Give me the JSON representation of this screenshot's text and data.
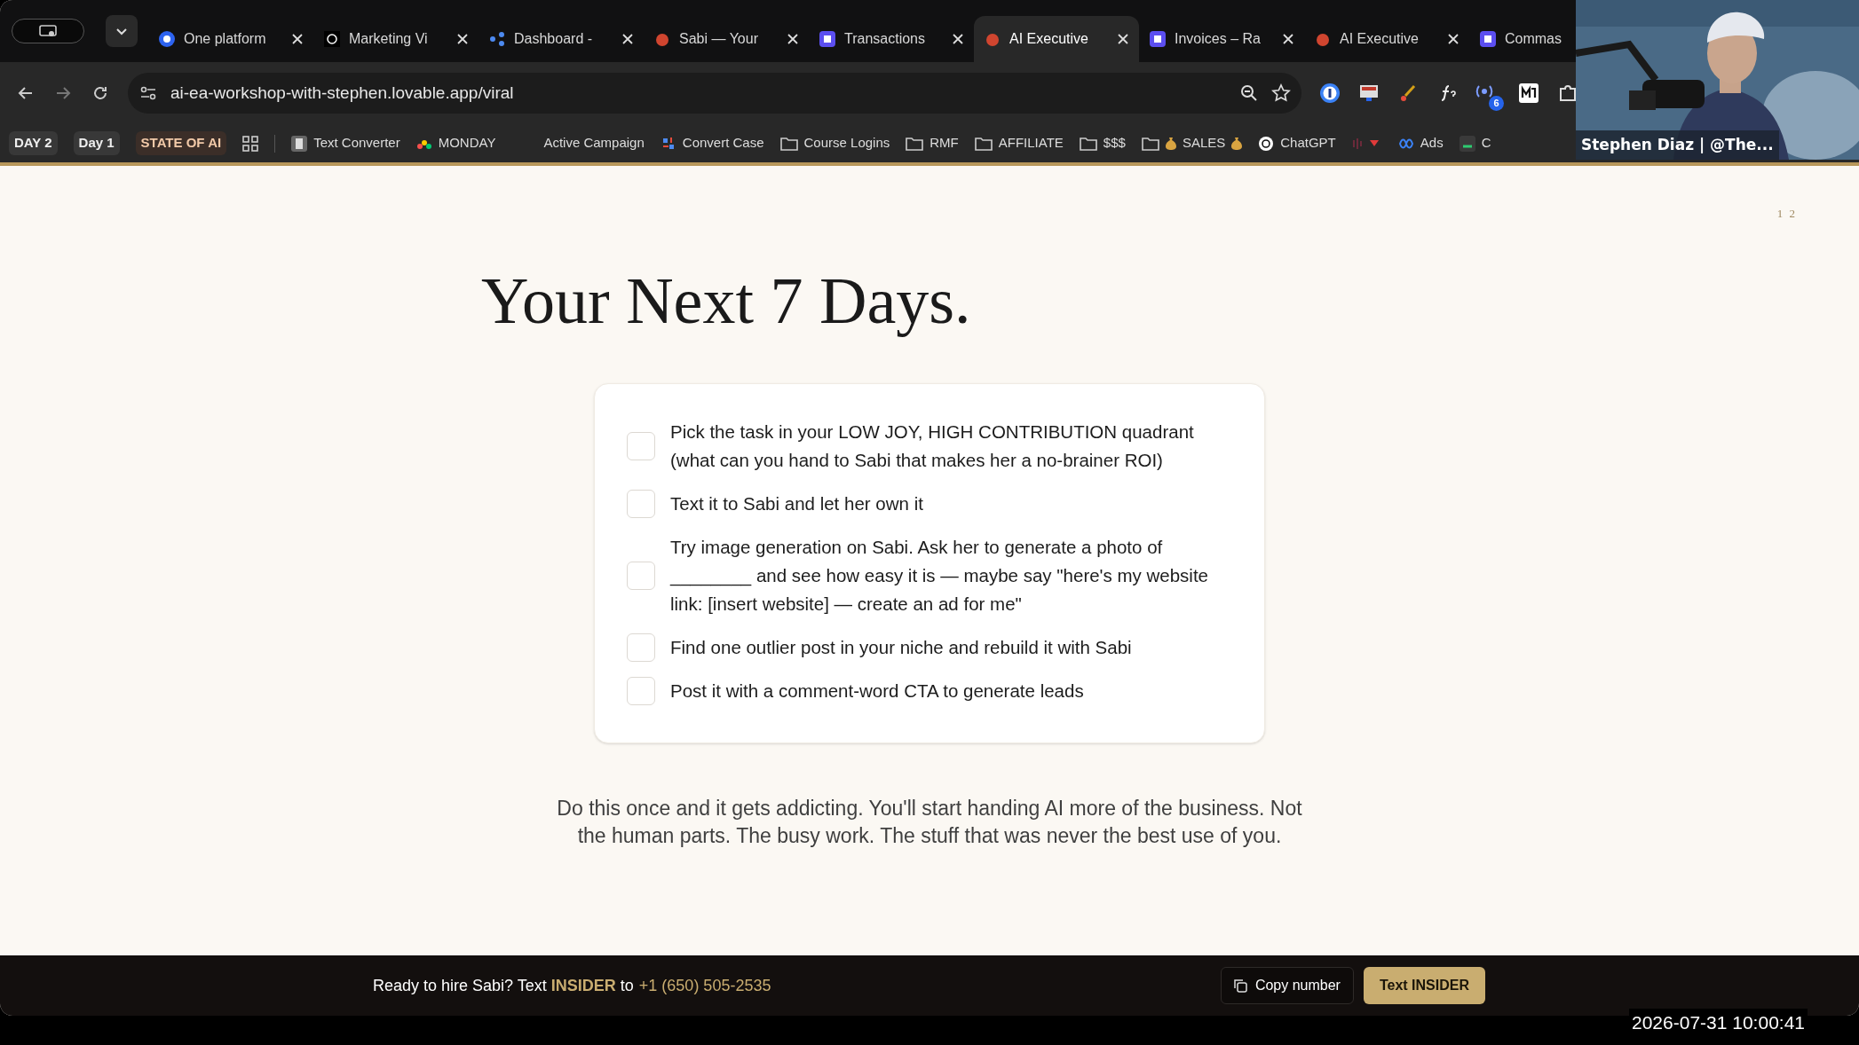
{
  "browser": {
    "tabs": [
      {
        "title": "One platform",
        "selected": false
      },
      {
        "title": "Marketing Vi",
        "selected": false
      },
      {
        "title": "Dashboard -",
        "selected": false
      },
      {
        "title": "Sabi — Your",
        "selected": false
      },
      {
        "title": "Transactions",
        "selected": false
      },
      {
        "title": "AI Executive",
        "selected": true
      },
      {
        "title": "Invoices – Ra",
        "selected": false
      },
      {
        "title": "AI Executive",
        "selected": false
      },
      {
        "title": "Commas",
        "selected": false
      }
    ],
    "url": "ai-ea-workshop-with-stephen.lovable.app/viral",
    "extension_badge": "6",
    "bookmarks": [
      {
        "label": "DAY 2",
        "kind": "pill"
      },
      {
        "label": "Day 1",
        "kind": "pill"
      },
      {
        "label": "STATE OF AI",
        "kind": "accent"
      },
      {
        "kind": "apps"
      },
      {
        "label": "Text Converter",
        "kind": "site"
      },
      {
        "label": "MONDAY",
        "kind": "site"
      },
      {
        "label": "Active Campaign",
        "kind": "plain"
      },
      {
        "label": "Convert Case",
        "kind": "site"
      },
      {
        "label": "Course Logins",
        "kind": "folder"
      },
      {
        "label": "RMF",
        "kind": "folder"
      },
      {
        "label": "AFFILIATE",
        "kind": "folder"
      },
      {
        "label": "$$$",
        "kind": "folder"
      },
      {
        "label": "SALES",
        "kind": "money"
      },
      {
        "label": "ChatGPT",
        "kind": "site"
      },
      {
        "kind": "redmark"
      },
      {
        "label": "Ads",
        "kind": "site"
      },
      {
        "label": "C",
        "kind": "site"
      }
    ]
  },
  "page": {
    "page_number": "1 2",
    "title": "Your Next 7 Days.",
    "checklist": [
      {
        "text": "Pick the task in your LOW JOY, HIGH CONTRIBUTION quadrant (what can you hand to Sabi that makes her a no-brainer ROI)",
        "checked": false
      },
      {
        "text": "Text it to Sabi and let her own it",
        "checked": false
      },
      {
        "text": "Try image generation on Sabi. Ask her to generate a photo of ________ and see how easy it is — maybe say \"here's my website link: [insert website] — create an ad for me\"",
        "checked": false
      },
      {
        "text": "Find one outlier post in your niche and rebuild it with Sabi",
        "checked": false
      },
      {
        "text": "Post it with a comment-word CTA to generate leads",
        "checked": false
      }
    ],
    "closing": "Do this once and it gets addicting. You'll start handing AI more of the business. Not the human parts. The busy work. The stuff that was never the best use of you."
  },
  "footer_bar": {
    "message": "Ready to hire Sabi? Text **INSIDER** to",
    "phone": "+1 (650) 505-2535",
    "buttons": [
      {
        "label": "Copy number",
        "kind": "secondary"
      },
      {
        "label": "Text INSIDER",
        "kind": "primary"
      }
    ]
  },
  "video_overlay": {
    "caption": "Stephen Diaz | @The..."
  },
  "timestamp": "2026-07-31 10:00:41"
}
